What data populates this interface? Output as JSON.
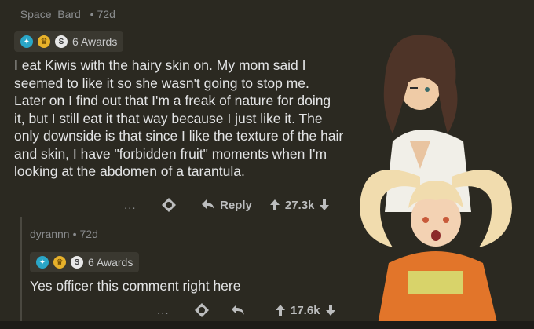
{
  "comments": [
    {
      "username": "_Space_Bard_",
      "age": "72d",
      "awards_label": "6 Awards",
      "body": "I eat Kiwis with the hairy skin on. My mom said I seemed to like it so she wasn't going to stop me. Later on I find out that I'm a freak of nature for doing it, but I still eat it that way because I just like it. The only downside is that since I like the texture of the hair and skin, I have \"forbidden fruit\" moments when I'm looking at the  abdomen of a tarantula.",
      "more": "...",
      "reply_label": "Reply",
      "score": "27.3k"
    },
    {
      "username": "dyrannn",
      "age": "72d",
      "awards_label": "6 Awards",
      "body": "Yes officer this comment right here",
      "more": "...",
      "score": "17.6k"
    }
  ],
  "separator": "•",
  "colors": {
    "background": "#2b2921",
    "text": "#e3e4e5",
    "muted": "#8a8c8e"
  },
  "icons": [
    "blue-award-icon",
    "gold-award-icon",
    "silver-award-icon",
    "gift-icon",
    "reply-arrow-icon",
    "upvote-icon",
    "downvote-icon"
  ]
}
